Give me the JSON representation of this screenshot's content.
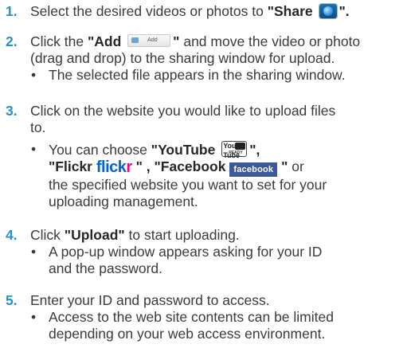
{
  "steps": [
    {
      "num": "1.",
      "pre": "Select the desired videos or photos to ",
      "bold": "\"Share",
      "icon": "share-globe-icon",
      "post": "\"."
    },
    {
      "num": "2.",
      "pre": "Click the ",
      "bold": "\"Add",
      "button_label": "Add",
      "bold_end": "\"",
      "post": " and move the video or photo",
      "line2": "(drag and drop) to the sharing window for upload.",
      "bullet": "The selected file appears in the sharing window."
    },
    {
      "num": "3.",
      "line1": "Click on the website you would like to upload files",
      "line2": "to.",
      "bullet_pre": "You can choose ",
      "youtube": "\"YouTube",
      "youtube_icon_text": "You Tube",
      "youtube_icon_sub": "READY",
      "youtube_end": "\",",
      "flickr": "\"Flickr",
      "flickr_logo_a": "flick",
      "flickr_logo_b": "r",
      "flickr_end": "\" , ",
      "facebook": "\"Facebook",
      "facebook_logo": "facebook",
      "facebook_end": "\"",
      "bullet_post": " or",
      "bullet_line3": "the specified website you want to set for your",
      "bullet_line4": "uploading management."
    },
    {
      "num": "4.",
      "pre": "Click ",
      "bold": "\"Upload\"",
      "post": " to start uploading.",
      "bullet_line1": "A pop-up window appears asking for your ID",
      "bullet_line2": "and the password."
    },
    {
      "num": "5.",
      "line1": "Enter your ID and password to access.",
      "bullet_line1": "Access to the web site contents can be limited",
      "bullet_line2": "depending on your web access environment."
    }
  ],
  "bullet_symbol": "•"
}
